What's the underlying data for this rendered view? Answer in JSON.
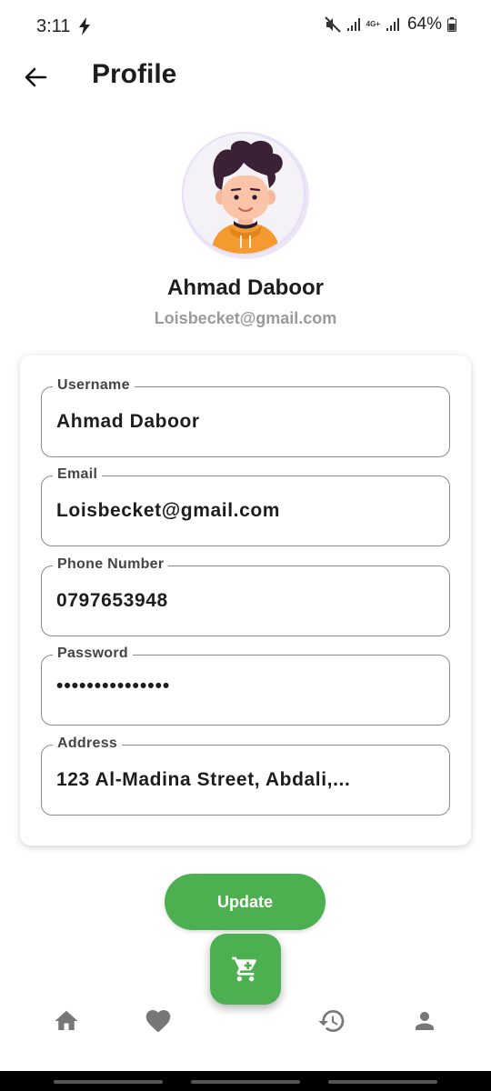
{
  "status_bar": {
    "time": "3:11",
    "network_label": "4G+",
    "battery": "64%"
  },
  "app_bar": {
    "title": "Profile",
    "back_icon": "arrow-left-icon"
  },
  "profile": {
    "name": "Ahmad Daboor",
    "email": "Loisbecket@gmail.com"
  },
  "form": {
    "fields": [
      {
        "label": "Username",
        "value": "Ahmad Daboor"
      },
      {
        "label": "Email",
        "value": "Loisbecket@gmail.com"
      },
      {
        "label": "Phone Number",
        "value": "0797653948"
      },
      {
        "label": "Password",
        "value": "•••••••••••••••"
      },
      {
        "label": "Address",
        "value": "123 Al-Madina Street, Abdali,..."
      }
    ],
    "update_label": "Update"
  },
  "bottom_nav": {
    "items": [
      {
        "icon": "home-icon"
      },
      {
        "icon": "heart-icon"
      },
      {
        "icon": "history-icon"
      },
      {
        "icon": "person-icon"
      }
    ],
    "fab_icon": "cart-icon"
  },
  "colors": {
    "accent": "#4caf50",
    "text_primary": "#1d1d1f",
    "text_secondary": "#9a9a9a",
    "nav_icon": "#777777"
  }
}
